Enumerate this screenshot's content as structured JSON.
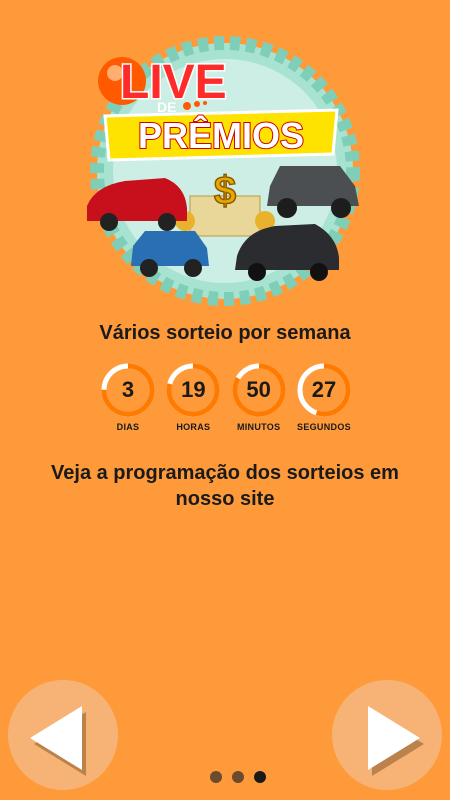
{
  "logo": {
    "live_text": "LIVE",
    "de_text": "DE",
    "premios_text": "PRÊMIOS",
    "dollar_symbol": "$"
  },
  "headline": "Vários sorteio por semana",
  "countdown": [
    {
      "value": "3",
      "label": "DIAS",
      "fraction": 0.75
    },
    {
      "value": "19",
      "label": "HORAS",
      "fraction": 0.79
    },
    {
      "value": "50",
      "label": "MINUTOS",
      "fraction": 0.83
    },
    {
      "value": "27",
      "label": "SEGUNDOS",
      "fraction": 0.55
    }
  ],
  "schedule_text": "Veja a programação dos sorteios em nosso site",
  "nav": {
    "prev_icon": "triangle-left-icon",
    "next_icon": "triangle-right-icon"
  },
  "pager": {
    "total": 3,
    "active": 2
  },
  "colors": {
    "background": "#ff9a3a",
    "ring_track": "#ffffff",
    "ring_progress": "#ff7a00",
    "button": "#f7b375"
  }
}
